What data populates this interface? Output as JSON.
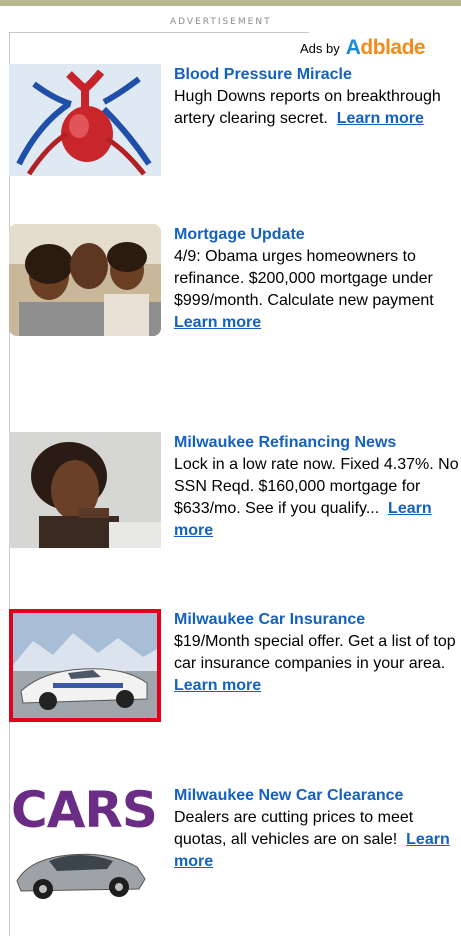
{
  "header": {
    "advertisement_label": "ADVERTISEMENT",
    "ads_by": "Ads by",
    "brand_first": "A",
    "brand_rest": "dblade"
  },
  "ads": [
    {
      "title": "Blood Pressure Miracle",
      "body": "Hugh Downs reports on breakthrough artery clearing secret.",
      "link": "Learn more",
      "image": "heart-illustration"
    },
    {
      "title": "Mortgage Update",
      "body": "4/9: Obama urges homeowners to refinance. $200,000 mortgage under $999/month. Calculate new payment",
      "link": "Learn more",
      "image": "family-photo"
    },
    {
      "title": "Milwaukee Refinancing News",
      "body": "Lock in a low rate now. Fixed 4.37%. No SSN Reqd. $160,000 mortgage for $633/mo. See if you qualify...",
      "link": "Learn more",
      "image": "woman-photo"
    },
    {
      "title": "Milwaukee Car Insurance",
      "body": "$19/Month special offer. Get a list of top car insurance companies in your area.",
      "link": "Learn more",
      "image": "race-car-photo"
    },
    {
      "title": "Milwaukee New Car Clearance",
      "body": "Dealers are cutting prices to meet quotas, all vehicles are on sale!",
      "link": "Learn more",
      "image": "cars-logo",
      "image_text": "CARS"
    }
  ]
}
